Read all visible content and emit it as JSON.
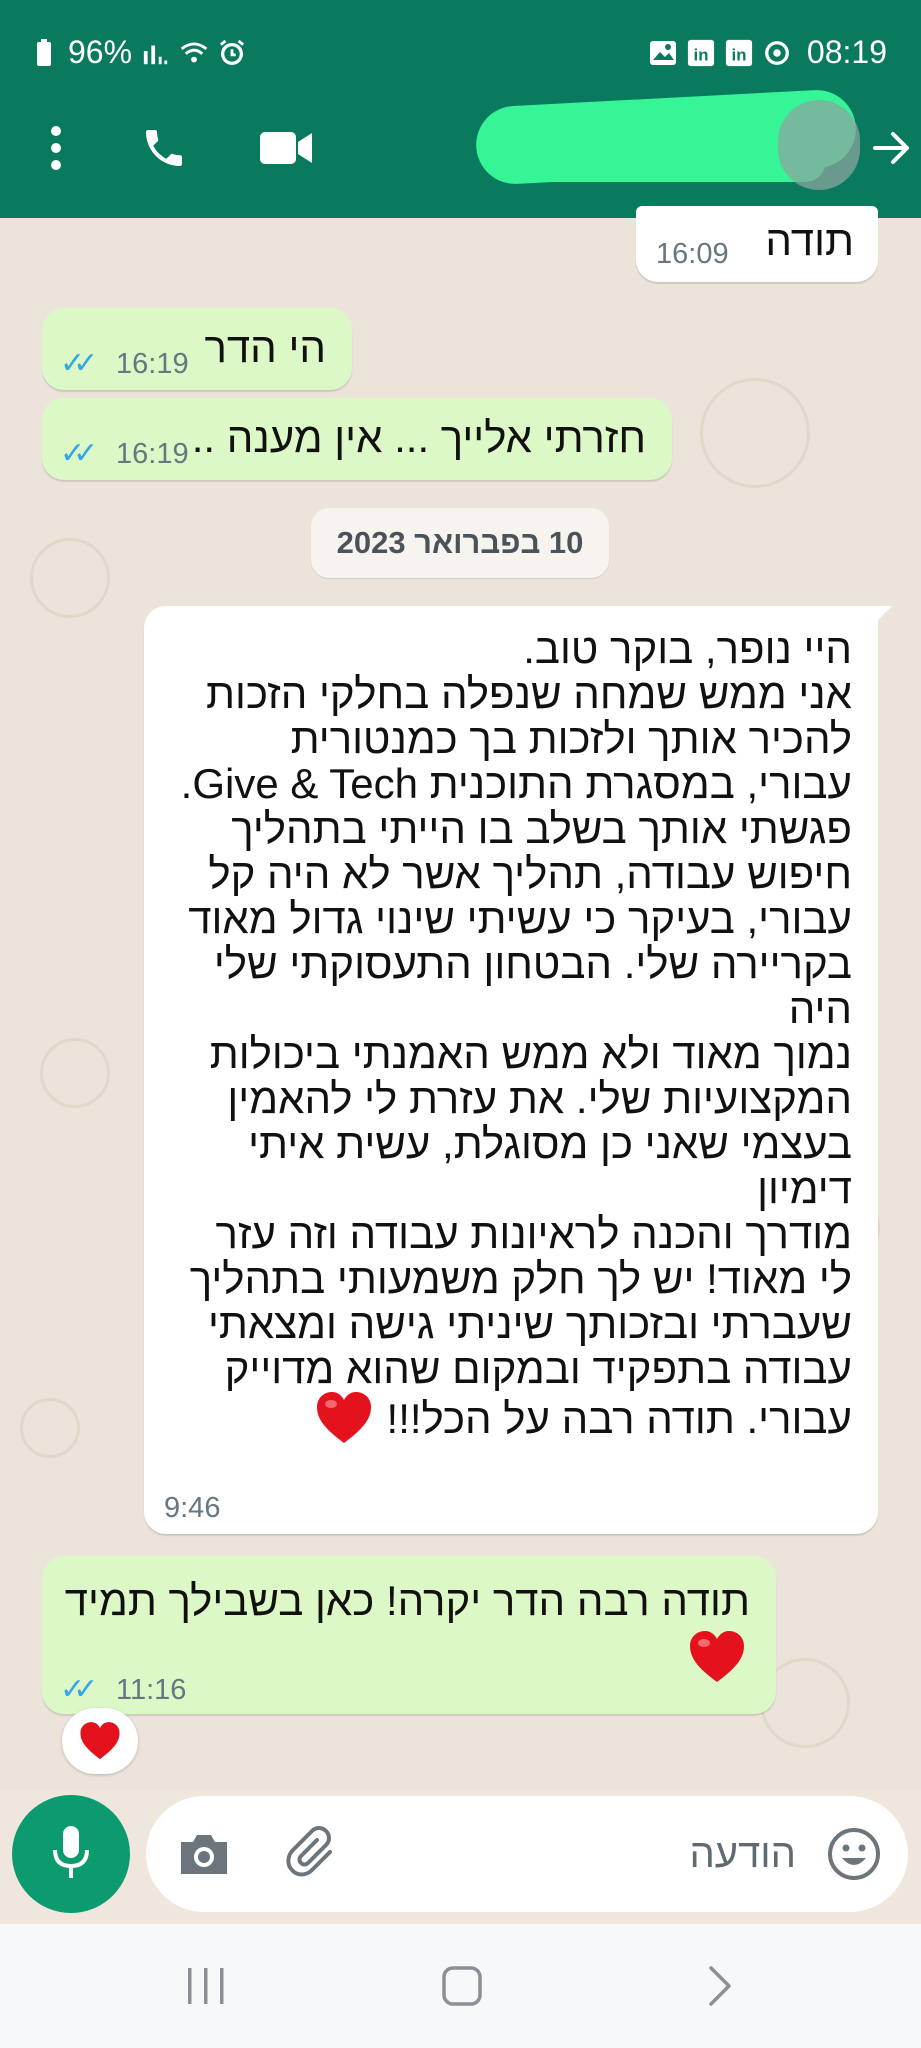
{
  "statusbar": {
    "battery": "96%",
    "time": "08:19"
  },
  "chat": {
    "messages": [
      {
        "dir": "in",
        "text": "תודה",
        "time": "16:09"
      },
      {
        "dir": "out",
        "text": "הי הדר",
        "time": "16:19"
      },
      {
        "dir": "out",
        "text": "חזרתי אלייך ... אין מענה ..",
        "time": "16:19"
      },
      {
        "dir": "in",
        "time": "9:46",
        "lines": [
          "היי נופר, בוקר טוב.",
          "אני ממש שמחה שנפלה בחלקי הזכות",
          "להכיר אותך ולזכות בך כמנטורית",
          "עבורי, במסגרת התוכנית Give & Tech.",
          "פגשתי אותך בשלב בו הייתי בתהליך",
          "חיפוש עבודה, תהליך אשר לא היה קל",
          "עבורי, בעיקר כי עשיתי שינוי גדול מאוד",
          "בקריירה שלי. הבטחון התעסוקתי שלי היה",
          "נמוך מאוד ולא ממש האמנתי ביכולות",
          "המקצועיות שלי. את עזרת לי להאמין",
          "בעצמי שאני כן מסוגלת, עשית איתי דימיון",
          "מודרך והכנה לראיונות עבודה וזה עזר",
          "לי מאוד! יש לך חלק משמעותי בתהליך",
          "שעברתי ובזכותך שיניתי גישה ומצאתי",
          "עבודה בתפקיד ובמקום שהוא מדוייק",
          "עבורי. תודה רבה על הכל!!!"
        ]
      },
      {
        "dir": "out",
        "text": "תודה רבה הדר יקרה! כאן בשבילך תמיד",
        "time": "11:16"
      }
    ],
    "date_separator": "10 בפברואר 2023"
  },
  "input": {
    "placeholder": "הודעה"
  },
  "icons": {
    "header": [
      "more-vert-icon",
      "phone-icon",
      "video-icon",
      "back-arrow-icon"
    ],
    "input": [
      "emoji-icon",
      "attach-icon",
      "camera-icon",
      "mic-icon"
    ],
    "nav": [
      "recents-icon",
      "home-icon",
      "back-icon"
    ]
  },
  "colors": {
    "header": "#0a7a5f",
    "incoming": "#ffffff",
    "outgoing": "#dbf8c6",
    "ticks": "#34a7e6",
    "mic": "#0c9b6f",
    "heart": "#e3121c"
  }
}
